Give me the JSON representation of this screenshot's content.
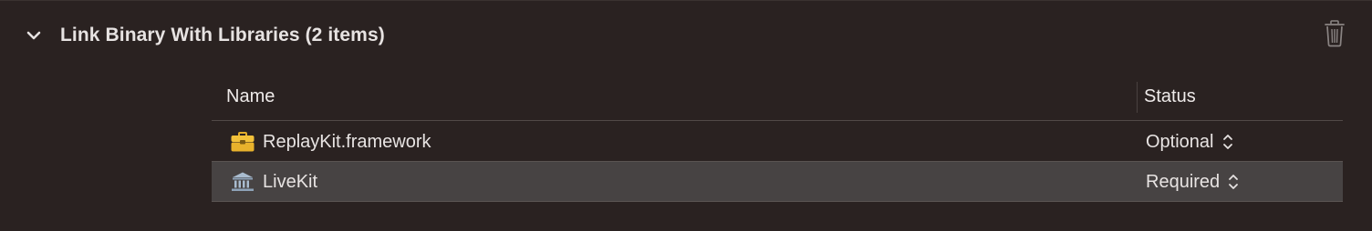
{
  "section": {
    "title": "Link Binary With Libraries (2 items)",
    "expanded": true,
    "icons": {
      "disclosure": "chevron-down-icon",
      "delete": "trash-icon"
    }
  },
  "table": {
    "columns": {
      "name": "Name",
      "status": "Status"
    },
    "rows": [
      {
        "name": "ReplayKit.framework",
        "icon": "toolbox-icon",
        "status": "Optional",
        "selected": false
      },
      {
        "name": "LiveKit",
        "icon": "library-building-icon",
        "status": "Required",
        "selected": true
      }
    ]
  },
  "colors": {
    "background": "#2a2221",
    "selected_row": "#474343",
    "toolbox_yellow": "#f2c13a",
    "library_blue": "#9fb3c8"
  }
}
